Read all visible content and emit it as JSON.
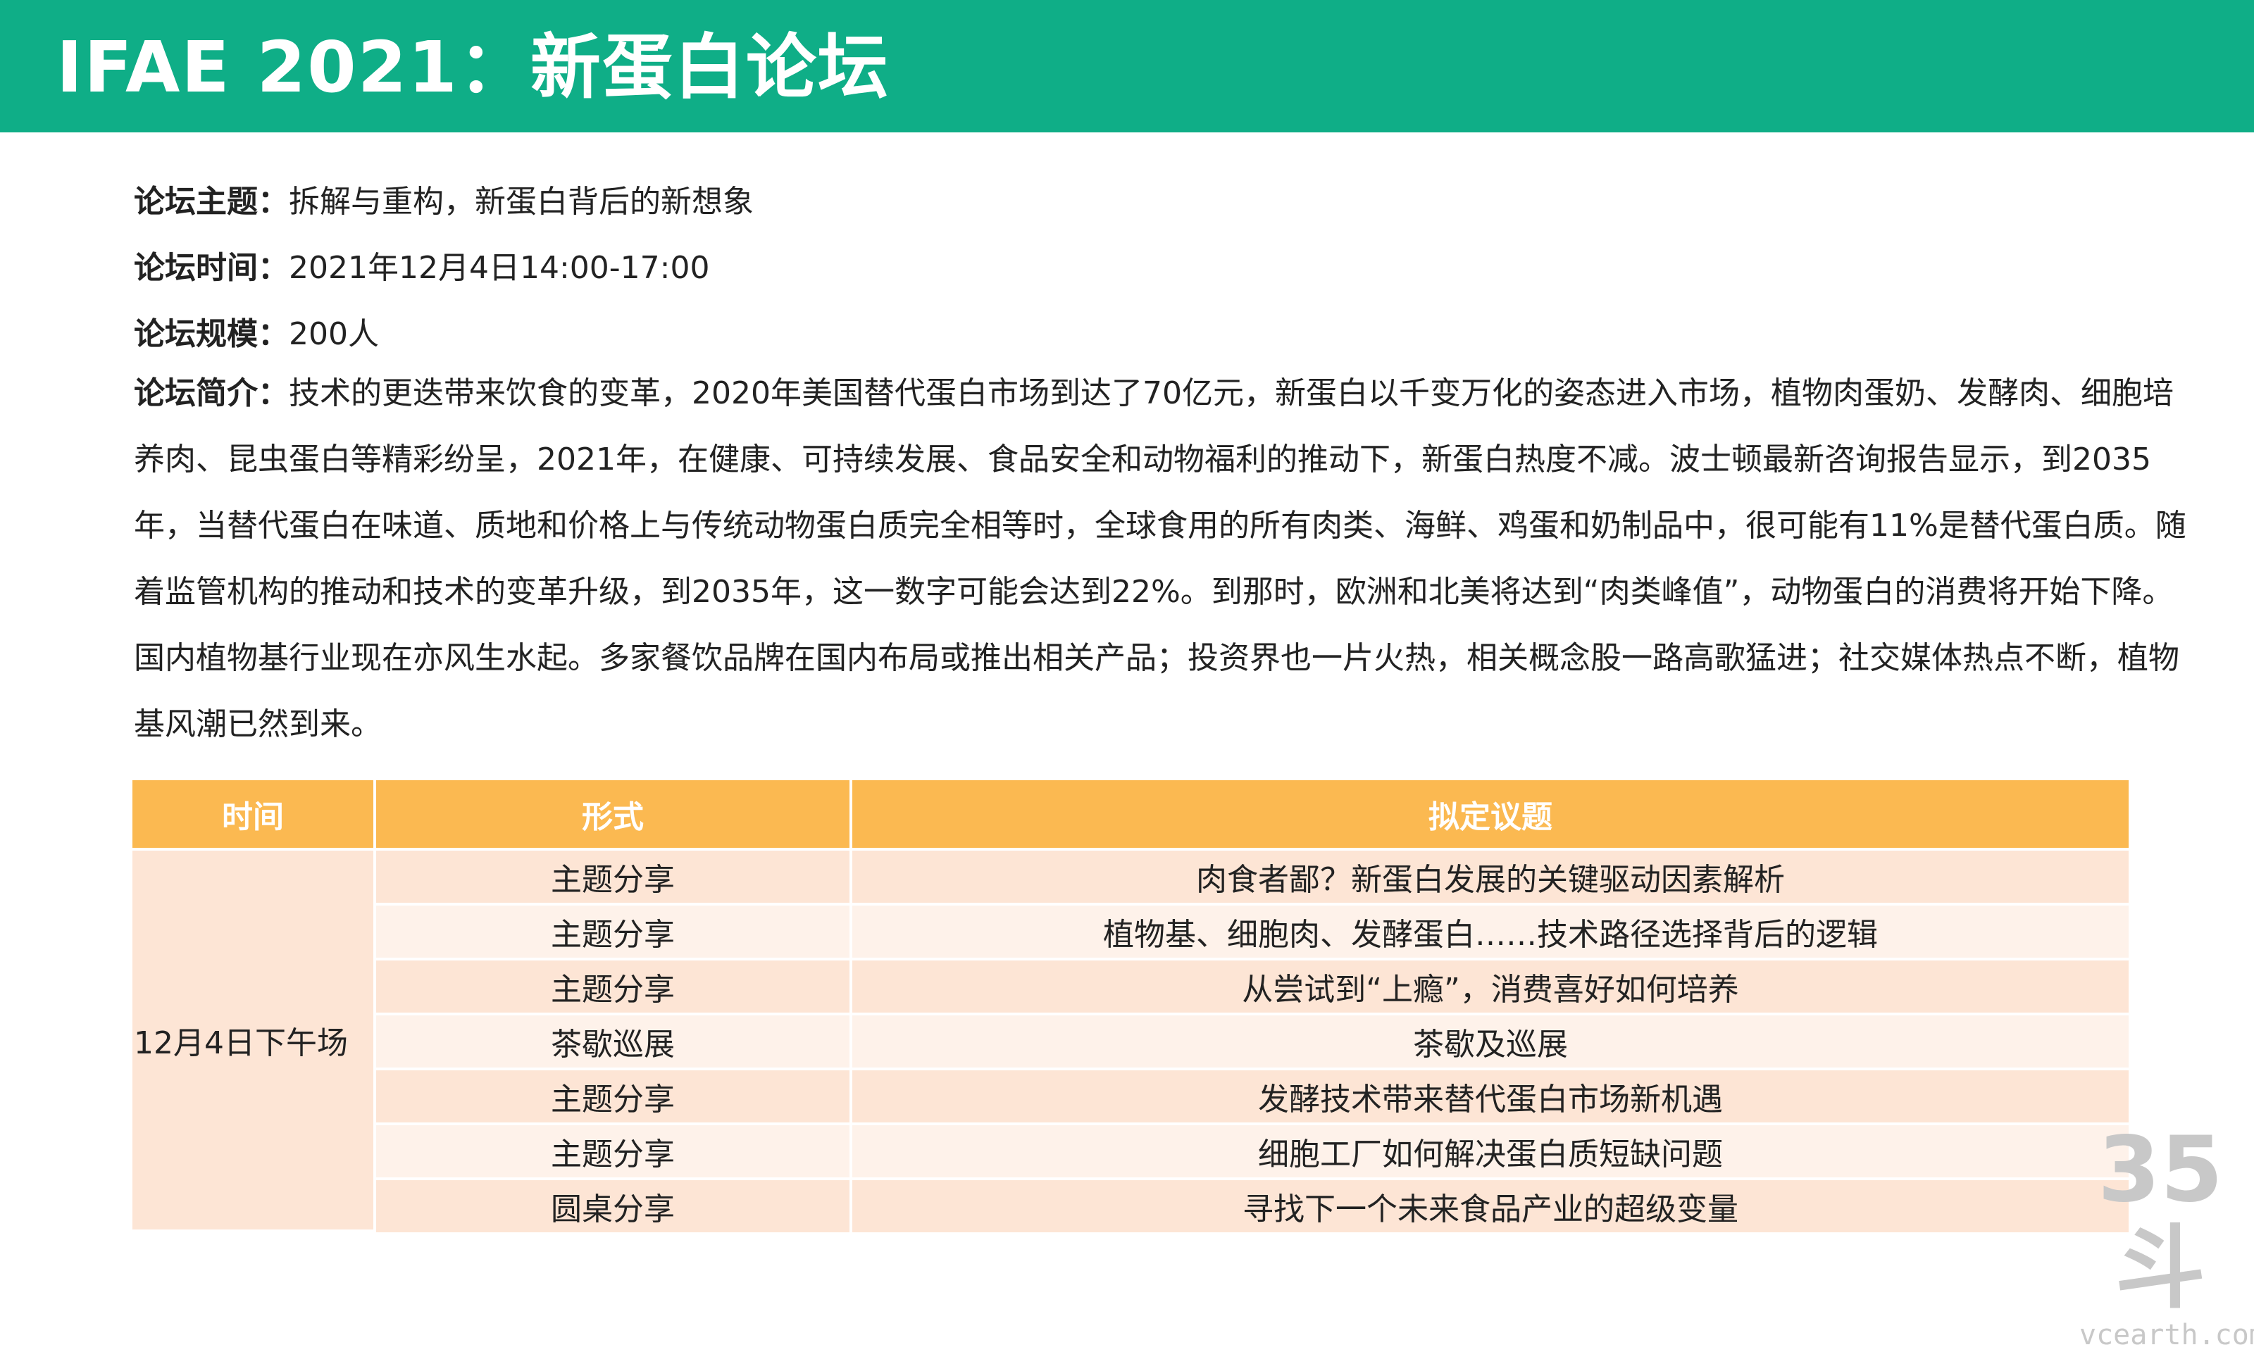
{
  "header": {
    "title": "IFAE 2021：新蛋白论坛"
  },
  "info": [
    {
      "label": "论坛主题：",
      "value": "拆解与重构，新蛋白背后的新想象"
    },
    {
      "label": "论坛时间：",
      "value": "2021年12月4日14:00-17:00"
    },
    {
      "label": "论坛规模：",
      "value": "200人"
    }
  ],
  "intro": {
    "label": "论坛简介：",
    "text": "技术的更迭带来饮食的变革，2020年美国替代蛋白市场到达了70亿元，新蛋白以千变万化的姿态进入市场，植物肉蛋奶、发酵肉、细胞培养肉、昆虫蛋白等精彩纷呈，2021年，在健康、可持续发展、食品安全和动物福利的推动下，新蛋白热度不减。波士顿最新咨询报告显示，到2035年，当替代蛋白在味道、质地和价格上与传统动物蛋白质完全相等时，全球食用的所有肉类、海鲜、鸡蛋和奶制品中，很可能有11%是替代蛋白质。随着监管机构的推动和技术的变革升级，到2035年，这一数字可能会达到22%。到那时，欧洲和北美将达到“肉类峰值”，动物蛋白的消费将开始下降。国内植物基行业现在亦风生水起。多家餐饮品牌在国内布局或推出相关产品；投资界也一片火热，相关概念股一路高歌猛进；社交媒体热点不断，植物基风潮已然到来。"
  },
  "schedule": {
    "headers": [
      "时间",
      "形式",
      "拟定议题"
    ],
    "session": "12月4日下午场",
    "rows": [
      {
        "format": "主题分享",
        "topic": "肉食者鄙？新蛋白发展的关键驱动因素解析"
      },
      {
        "format": "主题分享",
        "topic": "植物基、细胞肉、发酵蛋白……技术路径选择背后的逻辑"
      },
      {
        "format": "主题分享",
        "topic": "从尝试到“上瘾”，消费喜好如何培养"
      },
      {
        "format": "茶歇巡展",
        "topic": "茶歇及巡展"
      },
      {
        "format": "主题分享",
        "topic": "发酵技术带来替代蛋白市场新机遇"
      },
      {
        "format": "主题分享",
        "topic": "细胞工厂如何解决蛋白质短缺问题"
      },
      {
        "format": "圆桌分享",
        "topic": "寻找下一个未来食品产业的超级变量"
      }
    ]
  },
  "watermark": {
    "logo": "35斗",
    "url": "vcearth.com"
  },
  "colors": {
    "header_bg": "#0fae87",
    "table_header_bg": "#fbb951",
    "row_dark": "#fde5d5",
    "row_light": "#fef2ea"
  }
}
